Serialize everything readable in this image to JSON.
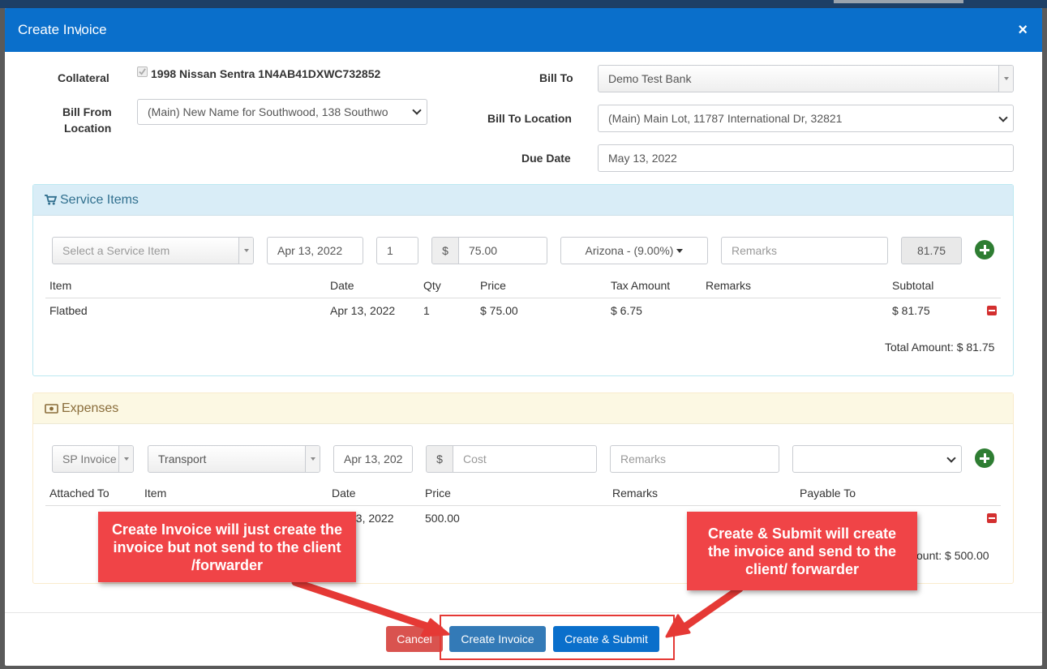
{
  "modal": {
    "title": "Create Invoice",
    "close_glyph": "×"
  },
  "form": {
    "collateral_label": "Collateral",
    "collateral_value": "1998 Nissan Sentra 1N4AB41DXWC732852",
    "bill_from_label_1": "Bill From",
    "bill_from_label_2": "Location",
    "bill_from_value": "(Main) New Name for Southwood, 138 Southwo",
    "bill_to_label": "Bill To",
    "bill_to_value": "Demo Test Bank",
    "bill_to_location_label": "Bill To Location",
    "bill_to_location_value": "(Main) Main Lot, 11787 International Dr, 32821",
    "due_date_label": "Due Date",
    "due_date_value": "May 13, 2022"
  },
  "service_items": {
    "title": "Service Items",
    "entry": {
      "service_placeholder": "Select a Service Item",
      "date": "Apr 13, 2022",
      "qty": "1",
      "currency": "$",
      "price": "75.00",
      "tax": "Arizona - (9.00%)",
      "remarks_placeholder": "Remarks",
      "subtotal": "81.75"
    },
    "headers": [
      "Item",
      "Date",
      "Qty",
      "Price",
      "Tax Amount",
      "Remarks",
      "Subtotal"
    ],
    "rows": [
      {
        "item": "Flatbed",
        "date": "Apr 13, 2022",
        "qty": "1",
        "price": "$ 75.00",
        "tax": "$ 6.75",
        "remarks": "",
        "subtotal": "$ 81.75"
      }
    ],
    "total": "Total Amount: $ 81.75"
  },
  "expenses": {
    "title": "Expenses",
    "entry": {
      "attached_to": "SP Invoice",
      "item": "Transport",
      "date": "Apr 13, 202",
      "currency": "$",
      "cost_placeholder": "Cost",
      "remarks_placeholder": "Remarks",
      "payable_to": ""
    },
    "headers": [
      "Attached To",
      "Item",
      "Date",
      "Price",
      "Remarks",
      "Payable To"
    ],
    "rows": [
      {
        "date_partial": "13, 2022",
        "price": "500.00"
      }
    ],
    "total_partial": "ount: $ 500.00"
  },
  "footer": {
    "cancel": "Cancel",
    "create_invoice": "Create Invoice",
    "create_submit": "Create & Submit"
  },
  "annotations": {
    "left": "Create Invoice will just create the invoice but not send to the client /forwarder",
    "right": "Create & Submit will create the invoice and send to the client/ forwarder"
  },
  "colors": {
    "header_blue": "#0a6fcb",
    "callout_red": "#f04447",
    "add_green": "#2e7d32",
    "remove_red": "#d32f2f"
  }
}
